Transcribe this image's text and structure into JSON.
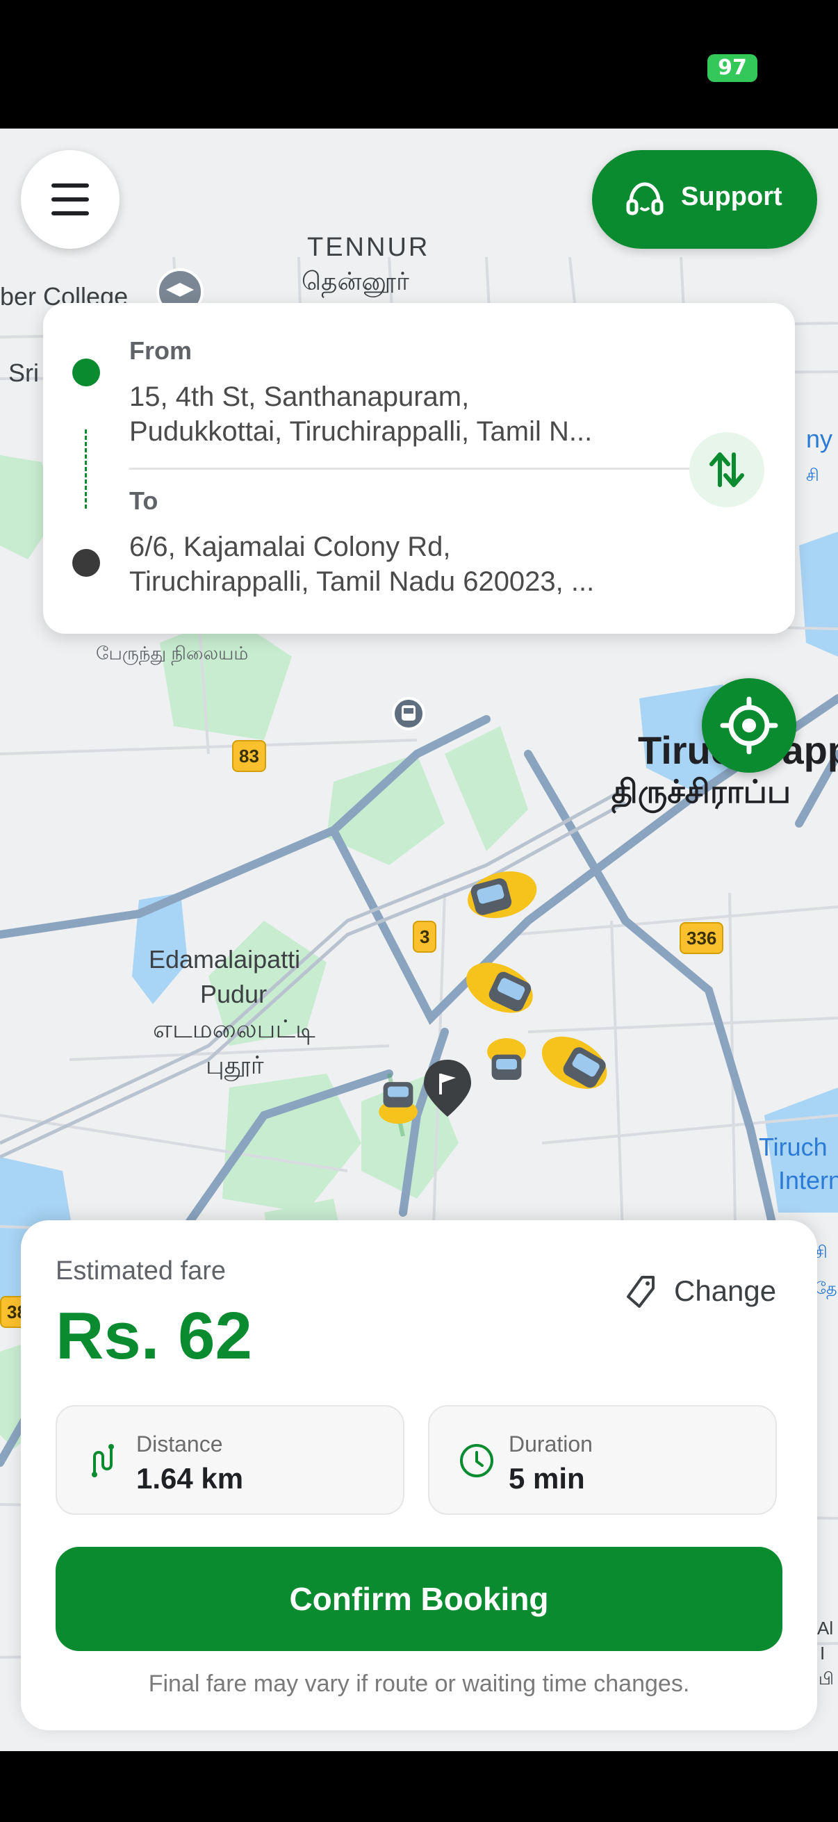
{
  "status_bar": {
    "battery": "97"
  },
  "map": {
    "labels": {
      "tennur_en": "TENNUR",
      "tennur_ta": "தென்னூர்",
      "college": "ber College",
      "sri": "Sri",
      "bus_stand_ta": "பேருந்து நிலையம்",
      "trichy_en": "Tiruchirapp",
      "trichy_ta": "திருச்சிராப்ப",
      "edamalaipatti_en_1": "Edamalaipatti",
      "edamalaipatti_en_2": "Pudur",
      "edamalaipatti_ta_1": "எடமலைபட்டி",
      "edamalaipatti_ta_2": "புதூர்",
      "tiruch_right": "Tiruch",
      "inter_right": "Intern",
      "right_ny": "ny",
      "right_si": "சி",
      "right_si2": "சி",
      "right_ge": "தே",
      "left_38": "38",
      "right_al": "Al",
      "right_i": "I",
      "right_pi": "பி"
    },
    "road_shields": [
      "83",
      "3",
      "336"
    ],
    "colors": {
      "park": "#c8ecd0",
      "water": "#a8d4f5",
      "road": "#9fb3c8"
    }
  },
  "header": {
    "menu_icon": "hamburger-menu-icon",
    "support_label": "Support",
    "support_icon": "headset-icon"
  },
  "route": {
    "from_label": "From",
    "from_address_line1": "15, 4th St, Santhanapuram,",
    "from_address_line2": "Pudukkottai, Tiruchirappalli, Tamil N...",
    "to_label": "To",
    "to_address_line1": "6/6, Kajamalai Colony Rd,",
    "to_address_line2": "Tiruchirappalli, Tamil Nadu 620023, ...",
    "swap_icon": "swap-vertical-icon"
  },
  "fare": {
    "label": "Estimated fare",
    "value": "Rs. 62",
    "change_label": "Change",
    "change_icon": "tag-edit-icon"
  },
  "stats": {
    "distance_label": "Distance",
    "distance_value": "1.64 km",
    "distance_icon": "route-icon",
    "duration_label": "Duration",
    "duration_value": "5 min",
    "duration_icon": "clock-icon"
  },
  "actions": {
    "confirm_label": "Confirm Booking",
    "footnote": "Final fare may vary if route or waiting time changes."
  },
  "colors": {
    "brand_green": "#0a8b2f",
    "vehicle_yellow": "#f6c21c"
  }
}
